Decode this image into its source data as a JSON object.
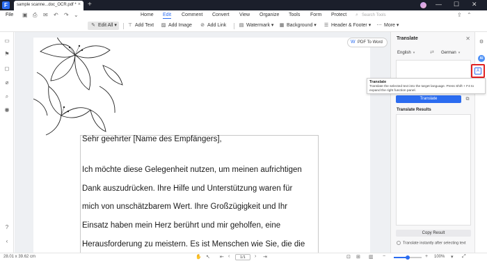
{
  "titlebar": {
    "tab_title": "sample scanne...doc_OCR.pdf *",
    "close": "×",
    "new_tab": "+",
    "minimize": "—",
    "maximize": "☐",
    "close_window": "✕"
  },
  "menubar": {
    "file": "File",
    "items": [
      "Home",
      "Edit",
      "Comment",
      "Convert",
      "View",
      "Organize",
      "Tools",
      "Form",
      "Protect"
    ],
    "active": "Edit",
    "search_placeholder": "Search Tools"
  },
  "toolbar": {
    "edit_all": "Edit All",
    "add_text": "Add Text",
    "add_image": "Add Image",
    "add_link": "Add Link",
    "watermark": "Watermark",
    "background": "Background",
    "header_footer": "Header & Footer",
    "more": "More"
  },
  "document": {
    "pdf_to_word": "PDF To Word",
    "lines": [
      "Sehr geehrter [Name des Empfängers],",
      "Ich möchte diese Gelegenheit nutzen, um meinen aufrichtigen",
      "Dank auszudrücken. Ihre Hilfe und Unterstützung waren für",
      "mich von unschätzbarem Wert. Ihre Großzügigkeit und Ihr",
      "Einsatz haben mein Herz berührt und mir geholfen, eine",
      "Herausforderung zu meistern. Es ist Menschen wie Sie, die die"
    ]
  },
  "panel": {
    "title": "Translate",
    "source_lang": "English",
    "target_lang": "German",
    "translate_button": "Translate",
    "results_label": "Translate Results",
    "copy_result": "Copy Result",
    "instant_label": "Translate instantly after selecting text"
  },
  "tooltip": {
    "title": "Translate",
    "body": "Translate the selected text into the target language. Press Shift + F4 to expand the right function panel."
  },
  "statusbar": {
    "dimensions": "28.01 x 39.62 cm",
    "page_display": "1/1",
    "zoom": "100%",
    "zoom_fraction": 0.5
  },
  "colors": {
    "accent": "#2b6cf0",
    "titlebar": "#1b1f2b",
    "highlight": "#e02020"
  }
}
